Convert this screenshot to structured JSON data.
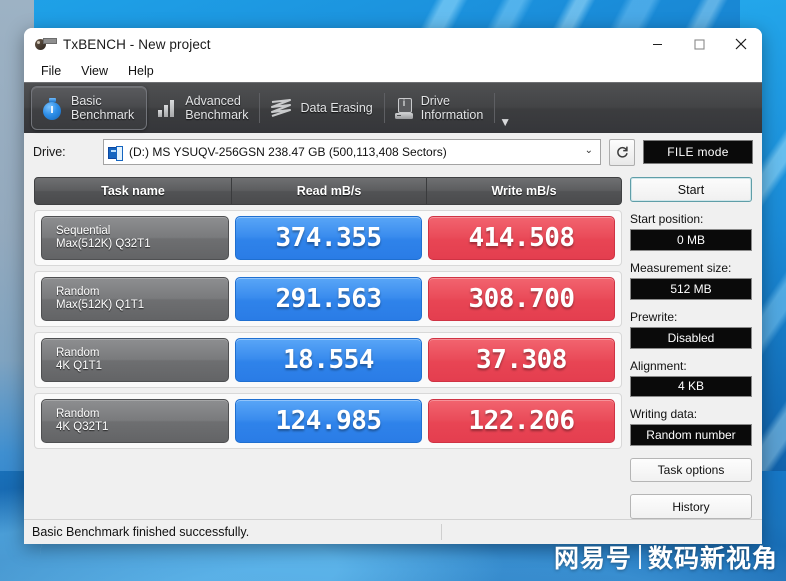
{
  "window": {
    "title": "TxBENCH - New project",
    "app_icon": "txbench-logo-icon",
    "controls": {
      "minimize": "minimize-icon",
      "maximize": "maximize-icon",
      "close": "close-icon"
    }
  },
  "menubar": {
    "items": [
      {
        "label": "File"
      },
      {
        "label": "View"
      },
      {
        "label": "Help"
      }
    ]
  },
  "tabs": {
    "items": [
      {
        "line1": "Basic",
        "line2": "Benchmark",
        "icon": "stopwatch-icon",
        "active": true
      },
      {
        "line1": "Advanced",
        "line2": "Benchmark",
        "icon": "bar-chart-icon",
        "active": false
      },
      {
        "line1": "Data Erasing",
        "line2": "",
        "icon": "data-erasing-icon",
        "active": false
      },
      {
        "line1": "Drive",
        "line2": "Information",
        "icon": "drive-information-icon",
        "active": false
      }
    ],
    "overflow_icon": "chevron-down-icon"
  },
  "drive_bar": {
    "label": "Drive:",
    "icon": "disk-icon",
    "selected": "(D:) MS    YSUQV-256GSN  238.47 GB (500,113,408 Sectors)",
    "chevron": "chevron-down-icon",
    "refresh_icon": "refresh-icon",
    "mode_button": "FILE mode"
  },
  "table": {
    "headers": {
      "task": "Task name",
      "read": "Read mB/s",
      "write": "Write mB/s"
    },
    "rows": [
      {
        "task_line1": "Sequential",
        "task_line2": "Max(512K) Q32T1",
        "read": "374.355",
        "write": "414.508"
      },
      {
        "task_line1": "Random",
        "task_line2": "Max(512K) Q1T1",
        "read": "291.563",
        "write": "308.700"
      },
      {
        "task_line1": "Random",
        "task_line2": "4K Q1T1",
        "read": "18.554",
        "write": "37.308"
      },
      {
        "task_line1": "Random",
        "task_line2": "4K Q32T1",
        "read": "124.985",
        "write": "122.206"
      }
    ]
  },
  "sidebar": {
    "start_button": "Start",
    "fields": [
      {
        "label": "Start position:",
        "value": "0 MB"
      },
      {
        "label": "Measurement size:",
        "value": "512 MB"
      },
      {
        "label": "Prewrite:",
        "value": "Disabled"
      },
      {
        "label": "Alignment:",
        "value": "4 KB"
      },
      {
        "label": "Writing data:",
        "value": "Random number"
      }
    ],
    "buttons": [
      {
        "label": "Task options"
      },
      {
        "label": "History"
      }
    ]
  },
  "statusbar": {
    "message": "Basic Benchmark finished successfully."
  },
  "watermark": {
    "left": "网易号",
    "right": "数码新视角"
  },
  "colors": {
    "read_blue": "#3a8cee",
    "write_red": "#ea4c5a",
    "tab_dark": "#43444 6",
    "accent_blue": "#1a8ad6"
  }
}
